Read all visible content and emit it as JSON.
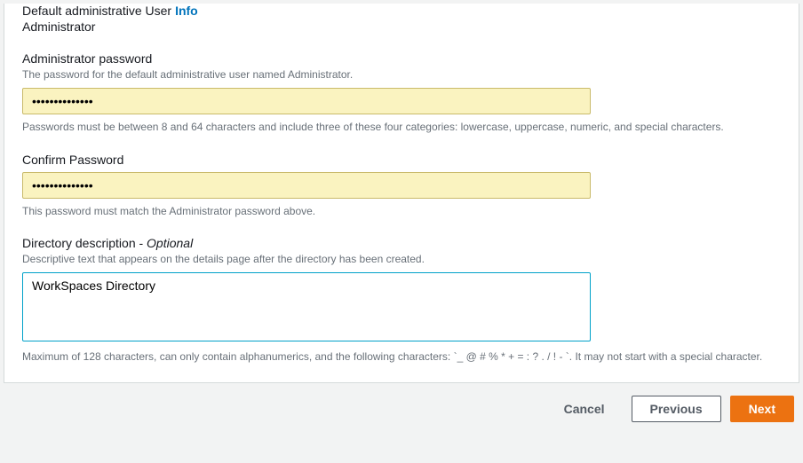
{
  "defaultUser": {
    "label": "Default administrative User",
    "infoLabel": "Info",
    "value": "Administrator"
  },
  "adminPassword": {
    "label": "Administrator password",
    "hint": "The password for the default administrative user named Administrator.",
    "value": "••••••••••••••",
    "constraint": "Passwords must be between 8 and 64 characters and include three of these four categories: lowercase, uppercase, numeric, and special characters."
  },
  "confirmPassword": {
    "label": "Confirm Password",
    "value": "••••••••••••••",
    "constraint": "This password must match the Administrator password above."
  },
  "description": {
    "label": "Directory description - ",
    "optional": "Optional",
    "hint": "Descriptive text that appears on the details page after the directory has been created.",
    "value": "WorkSpaces Directory",
    "constraint": "Maximum of 128 characters, can only contain alphanumerics, and the following characters: `_ @ # % * + = : ? . / ! - `. It may not start with a special character."
  },
  "footer": {
    "cancel": "Cancel",
    "previous": "Previous",
    "next": "Next"
  }
}
